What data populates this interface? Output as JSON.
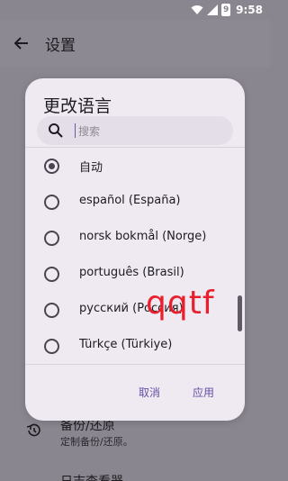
{
  "status_bar": {
    "time": "9:58",
    "battery_level": "9"
  },
  "app_bar": {
    "title": "设置"
  },
  "background_list": [
    {
      "title": "备份/还原",
      "subtitle": "定制备份/还原。",
      "icon": "backup-restore-icon"
    },
    {
      "title": "日志查看器",
      "subtitle": "",
      "icon": "log-icon"
    }
  ],
  "dialog": {
    "title": "更改语言",
    "search_placeholder": "搜索",
    "options": [
      {
        "label": "自动",
        "selected": true
      },
      {
        "label": "español (España)",
        "selected": false
      },
      {
        "label": "norsk bokmål (Norge)",
        "selected": false
      },
      {
        "label": "português (Brasil)",
        "selected": false
      },
      {
        "label": "русский (Россия)",
        "selected": false
      },
      {
        "label": "Türkçe (Türkiye)",
        "selected": false
      }
    ],
    "cancel_label": "取消",
    "apply_label": "应用"
  },
  "overlay_text": "qqtf",
  "colors": {
    "accent": "#6750a4",
    "scrim": "#8a8690",
    "dialog_bg": "#efe9f2",
    "overlay_text": "#e8202e"
  }
}
